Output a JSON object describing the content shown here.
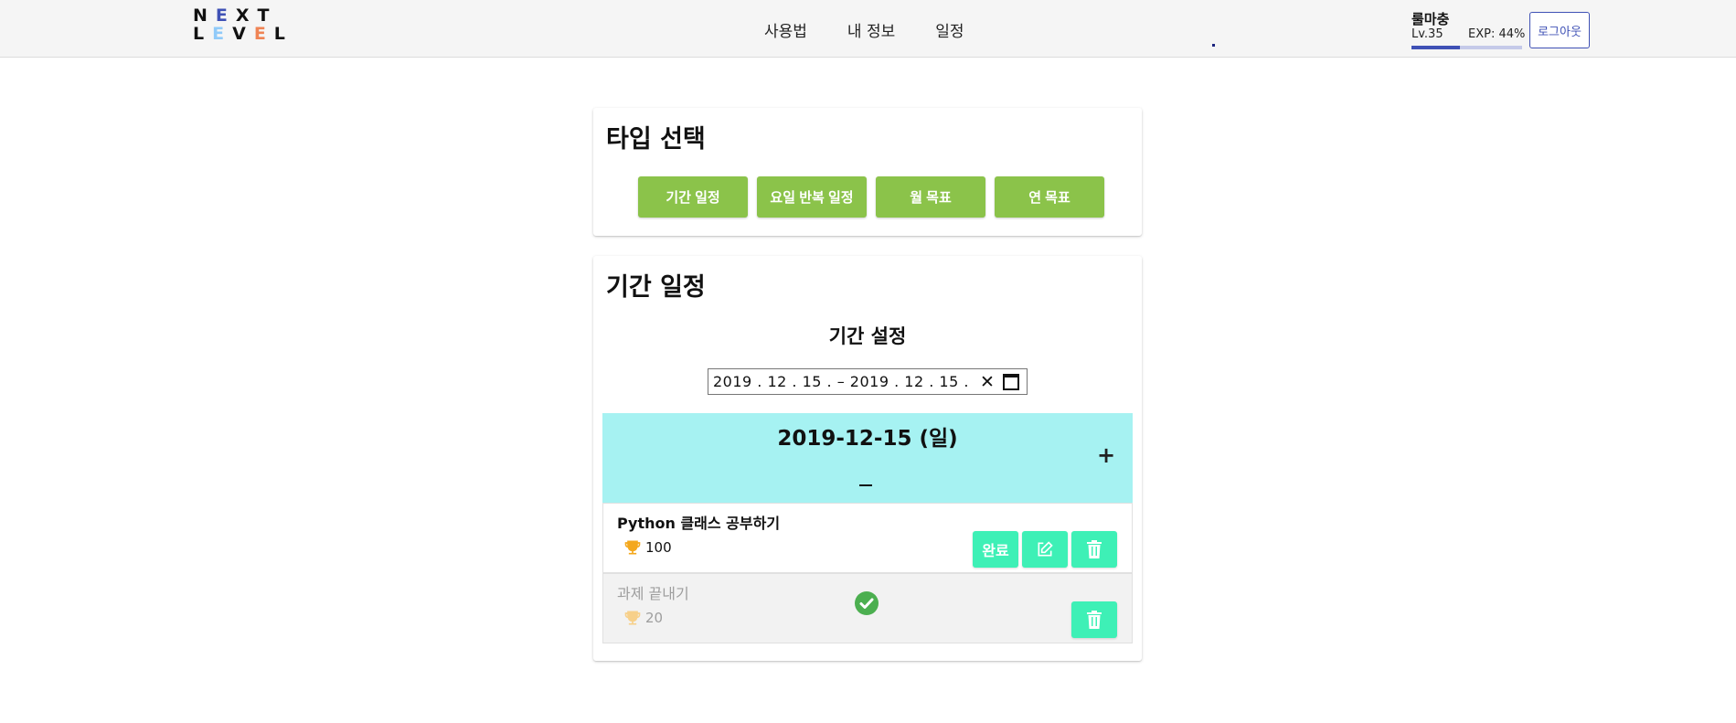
{
  "header": {
    "logo_line1": "NEXT",
    "logo_line2": "LEVEL",
    "nav": [
      "사용법",
      "내 정보",
      "일정"
    ],
    "user": {
      "name": "룰마충",
      "level": "Lv.35",
      "exp": "EXP: 44%",
      "exp_fraction": 0.44
    },
    "logout_label": "로그아웃"
  },
  "type_select": {
    "title": "타입 선택",
    "buttons": [
      "기간 일정",
      "요일 반복 일정",
      "월 목표",
      "연 목표"
    ]
  },
  "schedule": {
    "title": "기간 일정",
    "period_label": "기간 설정",
    "date_range": "2019 . 12 . 15 . – 2019 . 12 . 15 .",
    "day": {
      "date": "2019-12-15 (일)",
      "add_symbol": "+"
    },
    "tasks": [
      {
        "title": "Python 클래스 공부하기",
        "points": "100",
        "complete_label": "완료",
        "done": false
      },
      {
        "title": "과제 끝내기",
        "points": "20",
        "done": true
      }
    ]
  },
  "colors": {
    "type_button": "#8bc34a",
    "action_button": "#3ef0b6",
    "day_panel": "#a6f2f2",
    "done_check": "#4caf50",
    "trophy": "#f4a81d",
    "accent": "#3f51b5"
  }
}
